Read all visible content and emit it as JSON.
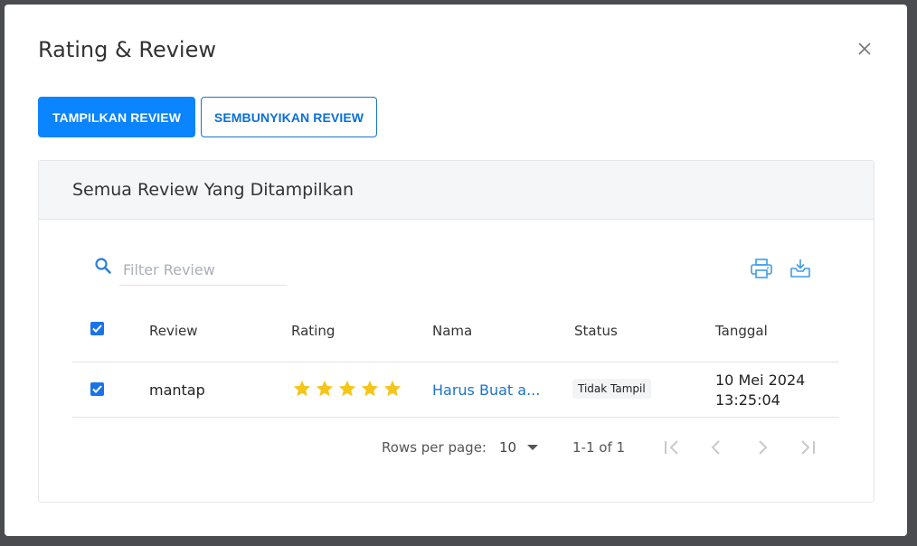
{
  "modal": {
    "title": "Rating & Review",
    "buttons": {
      "show": "TAMPILKAN REVIEW",
      "hide": "SEMBUNYIKAN REVIEW"
    }
  },
  "card": {
    "title": "Semua Review Yang Ditampilkan",
    "search": {
      "placeholder": "Filter Review",
      "value": ""
    }
  },
  "table": {
    "columns": [
      "Review",
      "Rating",
      "Nama",
      "Status",
      "Tanggal"
    ],
    "rows": [
      {
        "checked": true,
        "review": "mantap",
        "rating": 5,
        "nama": "Harus Buat a...",
        "status": "Tidak Tampil",
        "tanggal_date": "10 Mei 2024",
        "tanggal_time": "13:25:04"
      }
    ]
  },
  "pagination": {
    "rows_per_page_label": "Rows per page:",
    "rows_per_page": "10",
    "range": "1-1 of 1"
  },
  "colors": {
    "primary": "#0a84ff",
    "star": "#f5c518",
    "link": "#1a73c9",
    "icon_blue": "#2196f3"
  }
}
